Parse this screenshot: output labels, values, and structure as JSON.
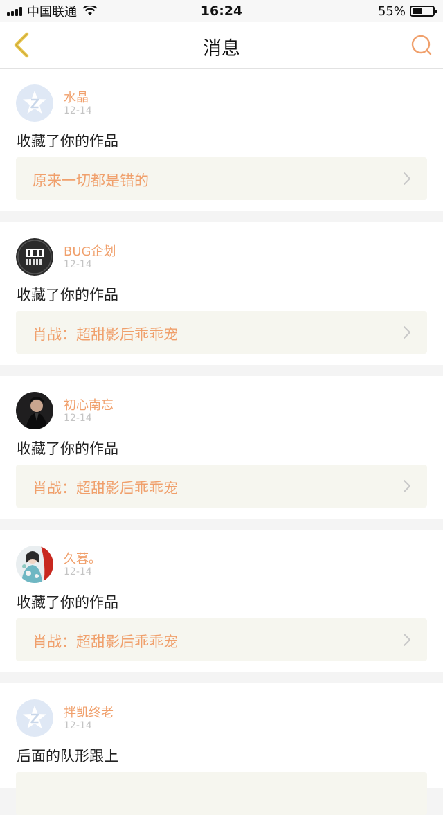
{
  "status_bar": {
    "carrier": "中国联通",
    "time": "16:24",
    "battery": "55%",
    "battery_level": 0.55
  },
  "nav": {
    "title": "消息",
    "back_icon": "chevron-left-icon",
    "search_icon": "search-icon"
  },
  "colors": {
    "accent": "#f0a06c",
    "back_icon": "#e8c54a",
    "work_box_bg": "#f6f6ef"
  },
  "messages": [
    {
      "user": "水晶",
      "date": "12-14",
      "action": "收藏了你的作品",
      "work": "原来一切都是错的",
      "avatar": "default-avatar-icon"
    },
    {
      "user": "BUG企划",
      "date": "12-14",
      "action": "收藏了你的作品",
      "work": "肖战：超甜影后乖乖宠",
      "avatar": "bug-logo-avatar"
    },
    {
      "user": "初心南忘",
      "date": "12-14",
      "action": "收藏了你的作品",
      "work": "肖战：超甜影后乖乖宠",
      "avatar": "photo-avatar"
    },
    {
      "user": "久暮。",
      "date": "12-14",
      "action": "收藏了你的作品",
      "work": "肖战：超甜影后乖乖宠",
      "avatar": "photo-avatar"
    },
    {
      "user": "拌凯终老",
      "date": "12-14",
      "action": "后面的队形跟上",
      "avatar": "default-avatar-icon"
    }
  ]
}
